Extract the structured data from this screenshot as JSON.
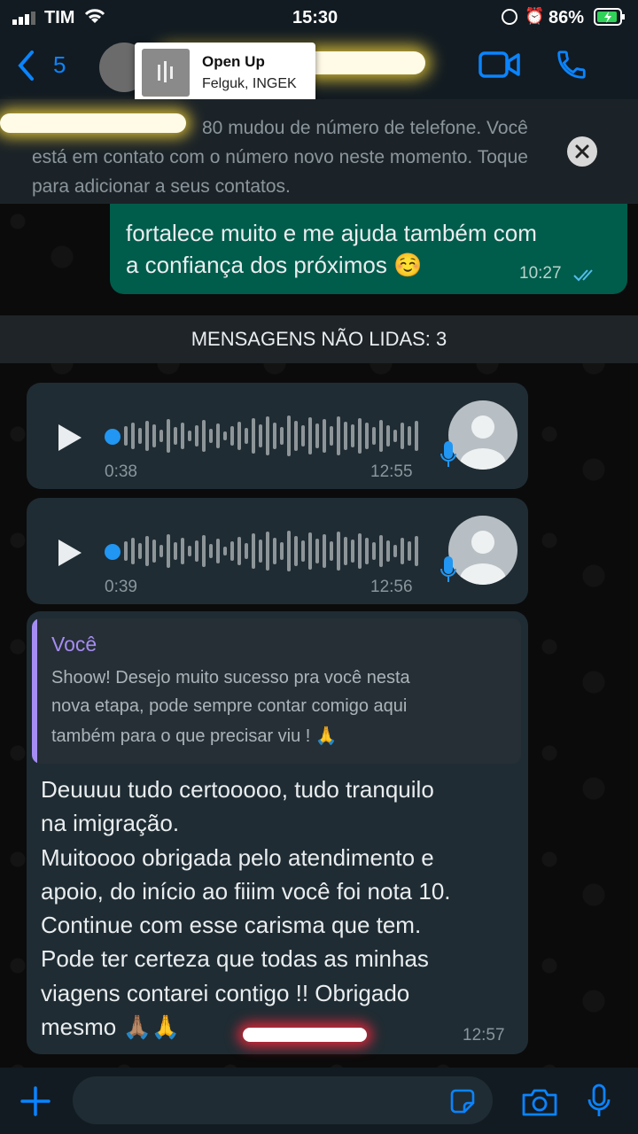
{
  "status_bar": {
    "carrier": "TIM",
    "time": "15:30",
    "battery": "86%"
  },
  "header": {
    "back_count": "5"
  },
  "now_playing": {
    "title": "Open Up",
    "artist": "Felguk, INGEK"
  },
  "banner": {
    "text": "80 mudou de número de telefone. Você está em contato com o número novo neste momento. Toque para adicionar a seus contatos."
  },
  "messages": {
    "outgoing": {
      "line1": "fortalece muito e me ajuda também com",
      "line2": "a confiança dos próximos ☺️",
      "time": "10:27"
    },
    "unread_divider": "MENSAGENS NÃO LIDAS: 3",
    "voice": [
      {
        "duration": "0:38",
        "time": "12:55"
      },
      {
        "duration": "0:39",
        "time": "12:56"
      }
    ],
    "reply": {
      "quote_author": "Você",
      "quote_line1": "Shoow! Desejo muito sucesso pra você nesta",
      "quote_line2": "nova etapa, pode sempre contar comigo aqui",
      "quote_line3": "também para o que precisar viu ! 🙏",
      "body_lines": [
        "Deuuuu tudo certooooo, tudo tranquilo",
        "na imigração.",
        "Muitoooo obrigada pelo atendimento e",
        "apoio, do início ao fiiim você foi nota 10.",
        "Continue com esse carisma que tem.",
        "Pode ter certeza que todas as minhas",
        "viagens contarei contigo !! Obrigado",
        "mesmo 🙏🏽🙏"
      ],
      "time": "12:57"
    }
  },
  "colors": {
    "accent": "#0a84ff",
    "outgoing_bubble": "#005c4b",
    "incoming_bubble": "#1f2c33",
    "quote_bar": "#a58cf2"
  }
}
